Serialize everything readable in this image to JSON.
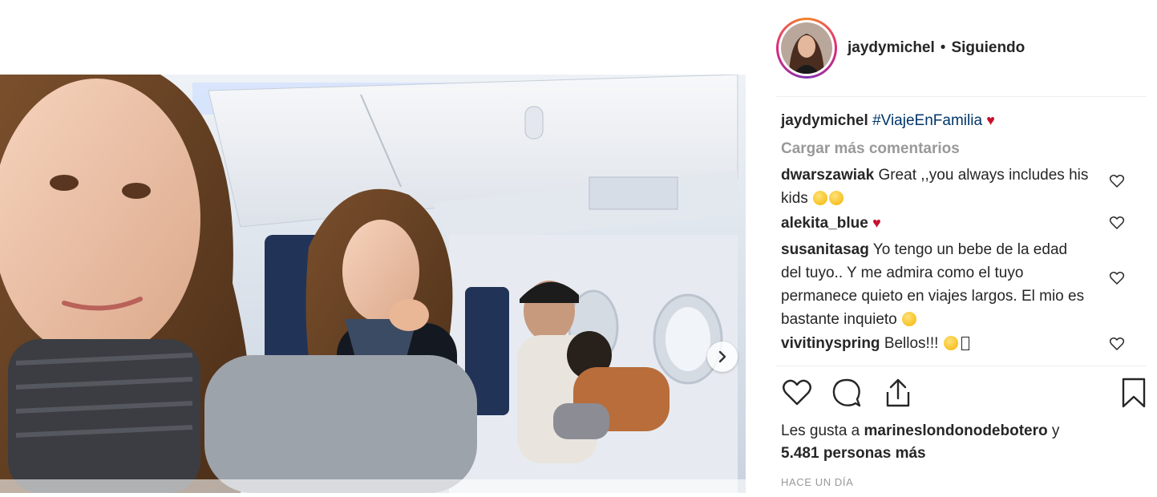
{
  "post": {
    "author": "jaydymichel",
    "separator": "•",
    "follow_status": "Siguiendo"
  },
  "caption": {
    "user": "jaydymichel",
    "hashtag": "#ViajeEnFamilia",
    "heart": "♥"
  },
  "load_more": "Cargar más comentarios",
  "comments": [
    {
      "user": "dwarszawiak",
      "text": "Great ,,you always includes his kids"
    },
    {
      "user": "alekita_blue",
      "text": ""
    },
    {
      "user": "susanitasag",
      "text": "Yo tengo un bebe de la edad del tuyo.. Y me admira como el tuyo permanece quieto en viajes largos. El mio es bastante inquieto"
    },
    {
      "user": "vivitinyspring",
      "text": "Bellos!!!"
    }
  ],
  "likes": {
    "prefix": "Les gusta a",
    "user": "marineslondonodebotero",
    "conjunction": "y",
    "others": "5.481 personas más"
  },
  "timestamp": "HACE UN DÍA",
  "icons": {
    "next": "chevron-right-icon",
    "like": "heart-outline-icon",
    "comment": "speech-bubble-icon",
    "share": "share-upload-icon",
    "save": "bookmark-icon"
  },
  "colors": {
    "hashtag": "#003569",
    "heart_red": "#c8102e",
    "muted": "#999999",
    "text": "#262626"
  }
}
